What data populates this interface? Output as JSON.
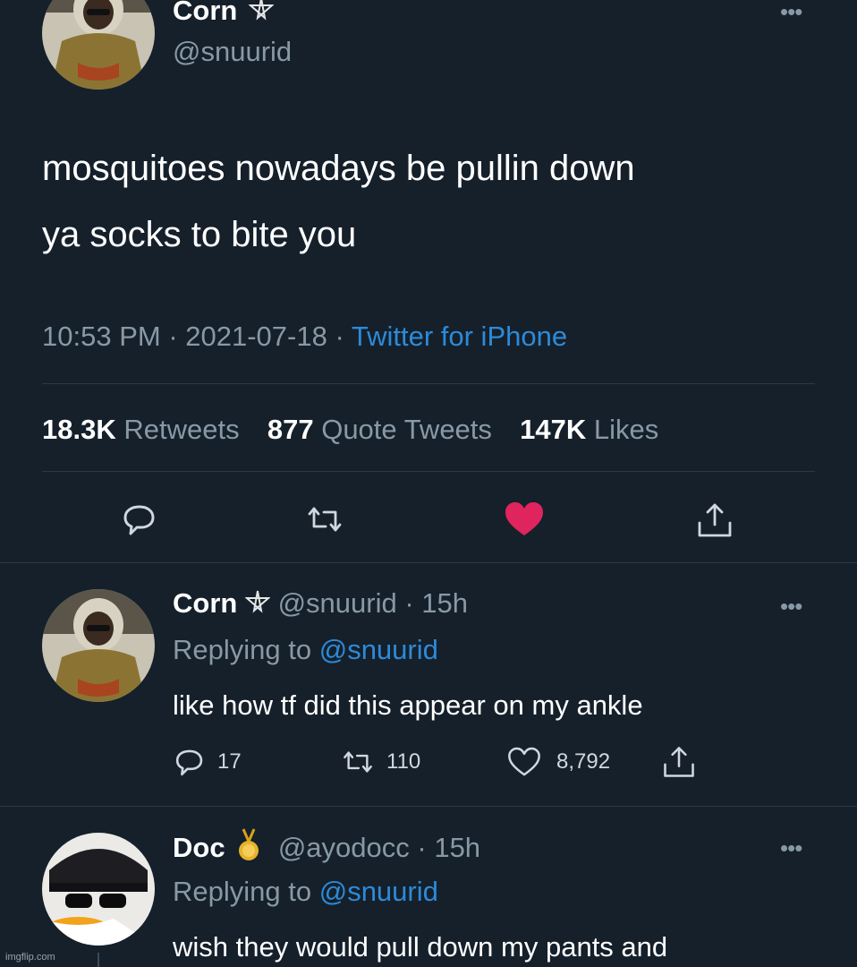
{
  "main_tweet": {
    "display_name": "Corn",
    "handle": "@snuurid",
    "text_line1": "mosquitoes nowadays be pullin down",
    "text_line2": "ya socks to bite you",
    "time": "10:53 PM",
    "date": "2021-07-18",
    "source": "Twitter for iPhone",
    "stats": {
      "retweets_count": "18.3K",
      "retweets_label": "Retweets",
      "quotes_count": "877",
      "quotes_label": "Quote Tweets",
      "likes_count": "147K",
      "likes_label": "Likes"
    }
  },
  "reply1": {
    "display_name": "Corn",
    "handle": "@snuurid",
    "time": "15h",
    "replying_prefix": "Replying to",
    "replying_to": "@snuurid",
    "text": "like how tf did this appear on my ankle",
    "reply_count": "17",
    "retweet_count": "110",
    "like_count": "8,792"
  },
  "reply2": {
    "display_name": "Doc",
    "handle": "@ayodocc",
    "time": "15h",
    "replying_prefix": "Replying to",
    "replying_to": "@snuurid",
    "text": "wish they would pull down my pants and"
  },
  "watermark": "imgflip.com",
  "colors": {
    "background": "#15202b",
    "muted": "#8899a6",
    "link": "#2d8ad8",
    "like_active": "#e0245e"
  },
  "icons": [
    "pentagram-icon",
    "more-dots-icon",
    "reply-icon",
    "retweet-icon",
    "heart-icon",
    "share-icon",
    "gold-medal-icon"
  ]
}
